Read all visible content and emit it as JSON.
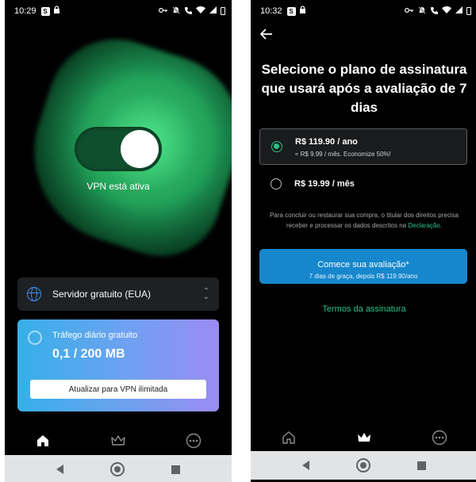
{
  "left_screen": {
    "status_bar": {
      "time": "10:29",
      "app_badge": "S"
    },
    "vpn_status": "VPN está ativa",
    "server": {
      "label": "Servidor gratuito (EUA)"
    },
    "traffic": {
      "title": "Tráfego diário gratuito",
      "value": "0,1 / 200 MB",
      "upgrade_label": "Atualizar para VPN ilimitada"
    },
    "nav": [
      "home-icon",
      "crown-icon",
      "more-icon"
    ],
    "nav_active": "home-icon"
  },
  "right_screen": {
    "status_bar": {
      "time": "10:32",
      "app_badge": "S"
    },
    "heading": "Selecione o plano de assinatura que usará após a avaliação de 7 dias",
    "plans": [
      {
        "price": "R$ 119.90 / ano",
        "subtitle": "≈ R$ 9.99 / mês. Economize 50%!",
        "selected": true
      },
      {
        "price": "R$ 19.99 / mês",
        "subtitle": "",
        "selected": false
      }
    ],
    "legal_text": "Para concluir ou restaurar sua compra, o titular dos direitos precisa receber e processar os dados descritos na ",
    "legal_link": "Declaração",
    "legal_end": ".",
    "cta": {
      "title": "Comece sua avaliação*",
      "subtitle": "7 dias de graça, depois R$ 119.90/ano"
    },
    "terms_link": "Termos da assinatura",
    "nav": [
      "home-icon",
      "crown-icon",
      "more-icon"
    ],
    "nav_active": "crown-icon"
  },
  "colors": {
    "accent_green": "#2bc48a",
    "vpn_glow": "#3dd27e",
    "cta_blue": "#1687cc",
    "globe_blue": "#3f8ef0"
  }
}
